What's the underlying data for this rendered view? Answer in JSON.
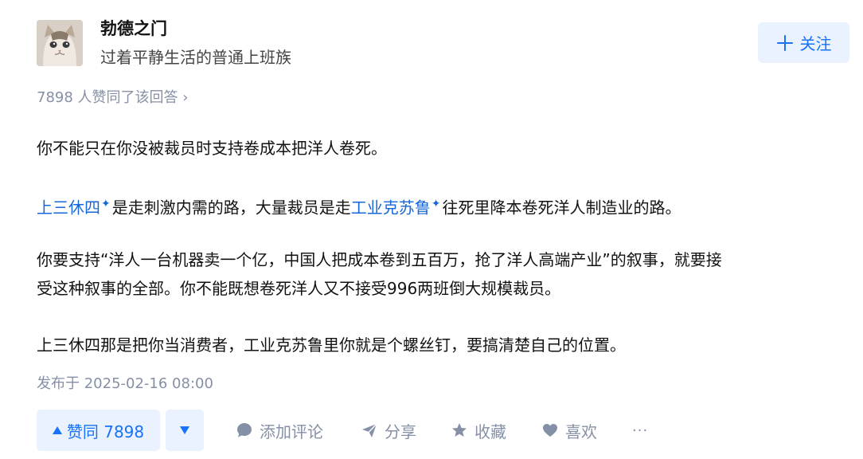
{
  "author": {
    "name": "勃德之门",
    "bio": "过着平静生活的普通上班族"
  },
  "follow_button": {
    "label": "关注",
    "icon": "plus-icon"
  },
  "votes_summary": "7898 人赞同了该回答 ›",
  "content": {
    "p1": "你不能只在你没被裁员时支持卷成本把洋人卷死。",
    "p2": {
      "link1": "上三休四",
      "text1": "是走刺激内需的路，大量裁员是走",
      "link2": "工业克苏鲁",
      "text2": "往死里降本卷死洋人制造业的路。"
    },
    "p3_line1": "你要支持“洋人一台机器卖一个亿，中国人把成本卷到五百万，抢了洋人高端产业”的叙事，就要接",
    "p3_line2": "受这种叙事的全部。你不能既想卷死洋人又不接受996两班倒大规模裁员。",
    "p4": "上三休四那是把你当消费者，工业克苏鲁里你就是个螺丝钉，要搞清楚自己的位置。"
  },
  "publish_time": "发布于 2025-02-16 08:00",
  "actions": {
    "vote_up": "赞同 7898",
    "comment": "添加评论",
    "share": "分享",
    "collect": "收藏",
    "like": "喜欢",
    "more": "···"
  },
  "colors": {
    "accent": "#1772f6",
    "link": "#1767d6",
    "muted": "#8590a6",
    "button_bg": "#eaf2ff"
  }
}
